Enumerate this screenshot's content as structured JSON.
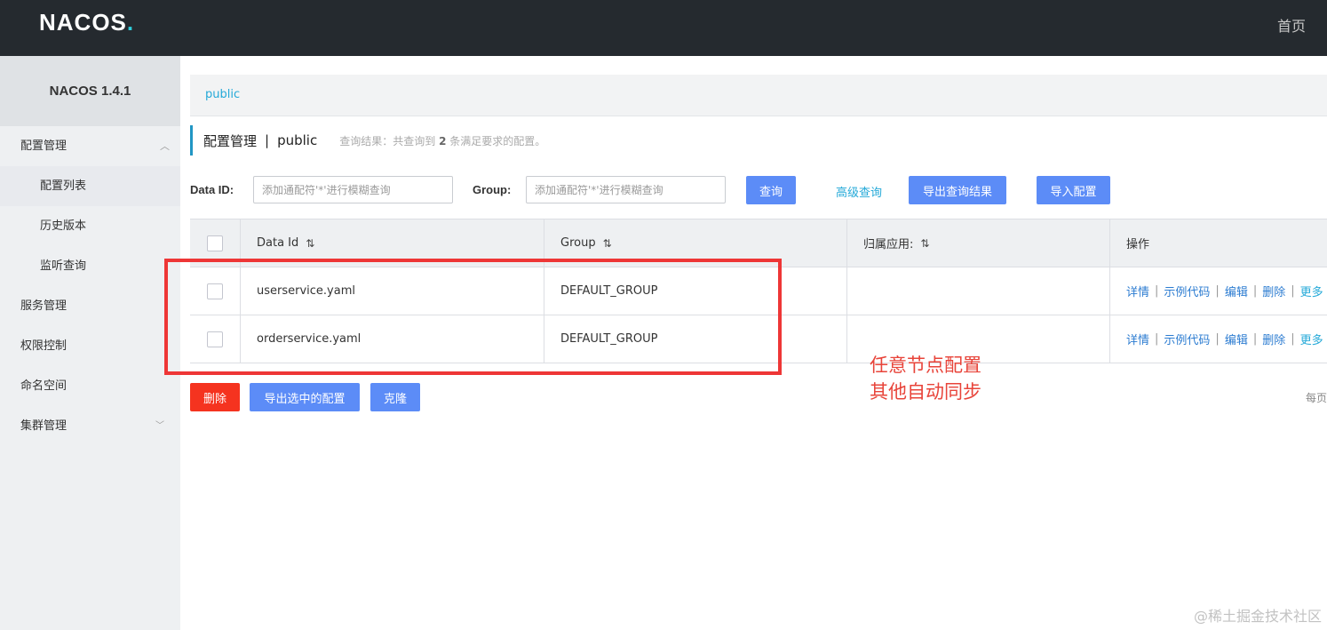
{
  "topbar": {
    "logo": "NACOS",
    "logo_dot": ".",
    "home": "首页"
  },
  "sidebar": {
    "version": "NACOS 1.4.1",
    "items": [
      {
        "label": "配置管理",
        "chevron": "^"
      },
      {
        "label": "配置列表"
      },
      {
        "label": "历史版本"
      },
      {
        "label": "监听查询"
      },
      {
        "label": "服务管理"
      },
      {
        "label": "权限控制"
      },
      {
        "label": "命名空间"
      },
      {
        "label": "集群管理",
        "chevron": "v"
      }
    ]
  },
  "namespace": {
    "current": "public"
  },
  "title": {
    "main": "配置管理",
    "sep": "|",
    "ns": "public",
    "result_prefix": "查询结果：共查询到",
    "result_count": "2",
    "result_suffix": "条满足要求的配置。"
  },
  "search": {
    "dataid_label": "Data ID:",
    "dataid_placeholder": "添加通配符'*'进行模糊查询",
    "group_label": "Group:",
    "group_placeholder": "添加通配符'*'进行模糊查询",
    "query_btn": "查询",
    "advanced_link": "高级查询",
    "export_result_btn": "导出查询结果",
    "import_btn": "导入配置"
  },
  "table": {
    "headers": {
      "dataid": "Data Id",
      "group": "Group",
      "app": "归属应用:",
      "ops": "操作",
      "sort_icon": "⇅"
    },
    "rows": [
      {
        "dataid": "userservice.yaml",
        "group": "DEFAULT_GROUP",
        "app": ""
      },
      {
        "dataid": "orderservice.yaml",
        "group": "DEFAULT_GROUP",
        "app": ""
      }
    ],
    "ops": {
      "detail": "详情",
      "sample": "示例代码",
      "edit": "编辑",
      "delete": "删除",
      "more": "更多",
      "sep": "|"
    }
  },
  "bottom": {
    "delete_btn": "删除",
    "export_selected_btn": "导出选中的配置",
    "clone_btn": "克隆",
    "per_page": "每页"
  },
  "annotation": {
    "line1": "任意节点配置",
    "line2": "其他自动同步"
  },
  "watermark": "@稀土掘金技术社区",
  "colors": {
    "topbar": "#252a2f",
    "primary": "#5c8cf7",
    "danger": "#f5331f",
    "link": "#24a9d8",
    "annotation": "#ee3636"
  }
}
